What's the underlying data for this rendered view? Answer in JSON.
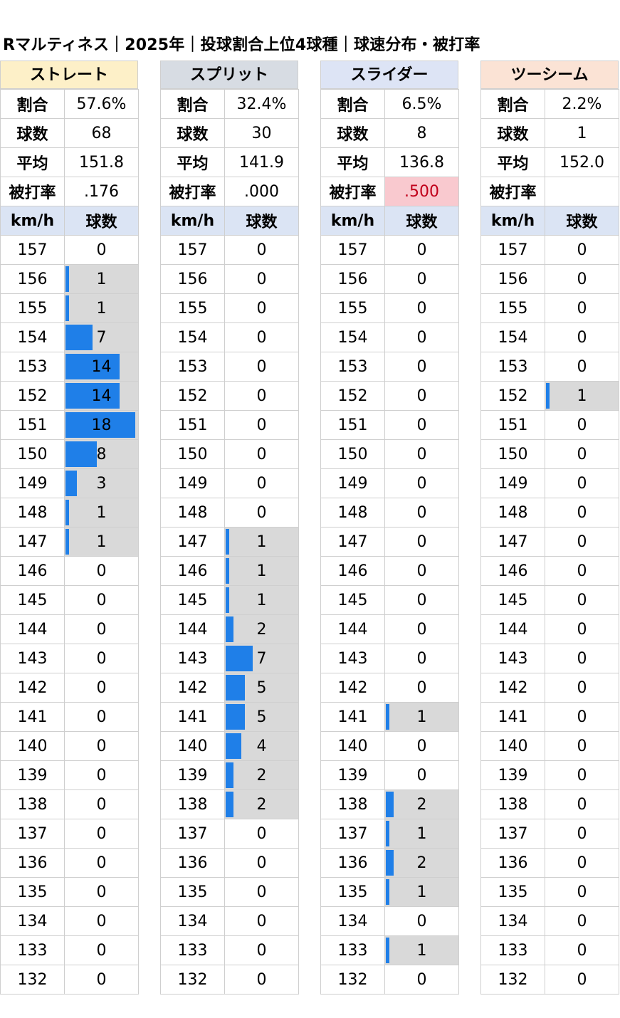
{
  "title": "Rマルティネス｜2025年｜投球割合上位4球種｜球速分布・被打率",
  "chart_data": {
    "type": "bar",
    "orientation": "horizontal",
    "speed_unit": "km/h",
    "count_label": "球数",
    "speeds": [
      157,
      156,
      155,
      154,
      153,
      152,
      151,
      150,
      149,
      148,
      147,
      146,
      145,
      144,
      143,
      142,
      141,
      140,
      139,
      138,
      137,
      136,
      135,
      134,
      133,
      132
    ],
    "bar_scale_max": 18,
    "colors": {
      "bar": "#1f7fe8",
      "cell_nonzero": "#d9d9d9",
      "highlight_bg": "#f9c9cf",
      "highlight_text": "#c0001a"
    },
    "stat_labels": {
      "ratio": "割合",
      "count": "球数",
      "avg": "平均",
      "ba": "被打率"
    },
    "pitches": [
      {
        "name": "ストレート",
        "header_color": "#fdf0c8",
        "ratio": "57.6%",
        "count": "68",
        "avg": "151.8",
        "ba": ".176",
        "ba_highlight": false,
        "values": [
          0,
          1,
          1,
          7,
          14,
          14,
          18,
          8,
          3,
          1,
          1,
          0,
          0,
          0,
          0,
          0,
          0,
          0,
          0,
          0,
          0,
          0,
          0,
          0,
          0,
          0
        ]
      },
      {
        "name": "スプリット",
        "header_color": "#d7dce3",
        "ratio": "32.4%",
        "count": "30",
        "avg": "141.9",
        "ba": ".000",
        "ba_highlight": false,
        "values": [
          0,
          0,
          0,
          0,
          0,
          0,
          0,
          0,
          0,
          0,
          1,
          1,
          1,
          2,
          7,
          5,
          5,
          4,
          2,
          2,
          0,
          0,
          0,
          0,
          0,
          0
        ]
      },
      {
        "name": "スライダー",
        "header_color": "#dde4f5",
        "ratio": "6.5%",
        "count": "8",
        "avg": "136.8",
        "ba": ".500",
        "ba_highlight": true,
        "values": [
          0,
          0,
          0,
          0,
          0,
          0,
          0,
          0,
          0,
          0,
          0,
          0,
          0,
          0,
          0,
          0,
          1,
          0,
          0,
          2,
          1,
          2,
          1,
          0,
          1,
          0
        ]
      },
      {
        "name": "ツーシーム",
        "header_color": "#fbe3d5",
        "ratio": "2.2%",
        "count": "1",
        "avg": "152.0",
        "ba": "",
        "ba_highlight": false,
        "values": [
          0,
          0,
          0,
          0,
          0,
          1,
          0,
          0,
          0,
          0,
          0,
          0,
          0,
          0,
          0,
          0,
          0,
          0,
          0,
          0,
          0,
          0,
          0,
          0,
          0,
          0
        ]
      }
    ]
  }
}
